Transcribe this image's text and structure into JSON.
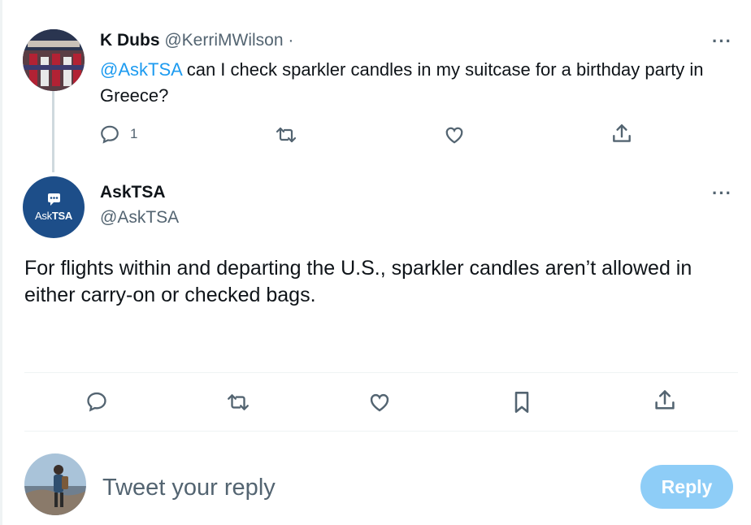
{
  "tweet1": {
    "name": "K Dubs",
    "handle": "@KerriMWilson",
    "separator": "·",
    "mention": "@AskTSA",
    "text": " can I check sparkler candles in my suitcase for a birthday party in Greece?",
    "reply_count": "1",
    "more_icon": "ellipsis-icon"
  },
  "tweet2": {
    "name": "AskTSA",
    "handle": "@AskTSA",
    "avatar_logo_text_ask": "Ask",
    "avatar_logo_text_tsa": "TSA",
    "text": "For flights within and departing the U.S., sparkler candles aren’t allowed in either carry-on or checked bags.",
    "more_icon": "ellipsis-icon"
  },
  "reply_box": {
    "placeholder": "Tweet your reply",
    "button_label": "Reply"
  },
  "colors": {
    "accent": "#1d9bf0",
    "reply_button_disabled": "#8ecdf7",
    "secondary_text": "#536471",
    "tsa_blue": "#1d4e89"
  },
  "icons": [
    "reply-icon",
    "retweet-icon",
    "like-icon",
    "bookmark-icon",
    "share-icon"
  ]
}
